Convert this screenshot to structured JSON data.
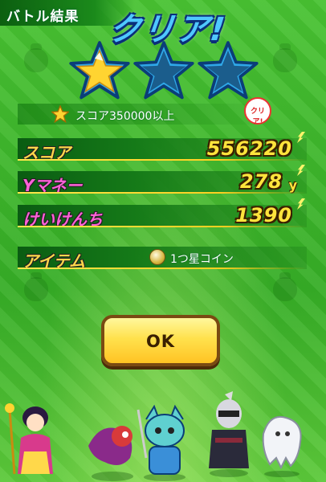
{
  "header": {
    "title": "バトル結果",
    "result": "クリア!"
  },
  "stars": {
    "earned": 1,
    "total": 3,
    "colors": {
      "earned": "#ffd431",
      "empty": "#1b5d8c",
      "outline": "#2fa8e8"
    }
  },
  "condition": {
    "text": "スコア350000以上",
    "badge": "クリア!"
  },
  "results": {
    "score": {
      "label": "スコア",
      "value": "556220",
      "label_color": "#ffd84a"
    },
    "money": {
      "label": "Yマネー",
      "value": "278",
      "unit": "y",
      "label_color": "#ff61d8"
    },
    "exp": {
      "label": "けいけんち",
      "value": "1390",
      "label_color": "#ff61d8"
    },
    "item": {
      "label": "アイテム",
      "name": "1つ星コイン",
      "label_color": "#ffd84a"
    }
  },
  "actions": {
    "ok_label": "OK"
  },
  "characters": [
    "princess-yokai",
    "snake-yokai",
    "knight-cat-yokai",
    "ninja-yokai",
    "ghost-yokai"
  ]
}
